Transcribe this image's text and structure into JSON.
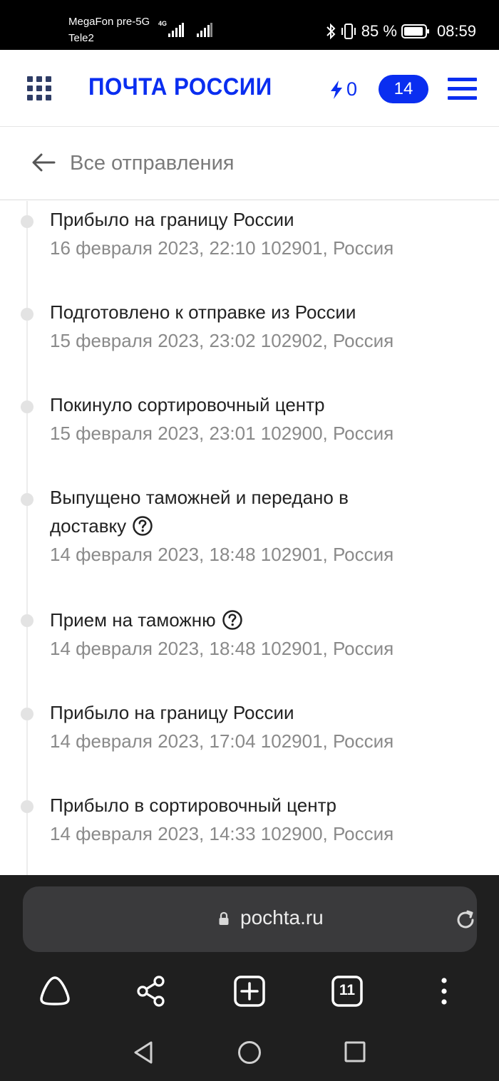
{
  "status_bar": {
    "carrier_primary": "MegaFon pre-5G",
    "carrier_secondary": "Tele2",
    "network_type": "4G",
    "battery_percent": "85 %",
    "time": "08:59",
    "icons": [
      "signal-icon",
      "bluetooth-icon",
      "vibrate-icon",
      "battery-icon"
    ]
  },
  "header": {
    "logo_text": "ПОЧТА РОССИИ",
    "bolt_count": "0",
    "badge_count": "14",
    "accent_color": "#0a2ef0"
  },
  "subheader": {
    "back_label": "Все отправления"
  },
  "events": [
    {
      "title": "Прибыло на границу России",
      "datetime": "16 февраля 2023, 22:10",
      "location": "102901, Россия",
      "meta": "16 февраля 2023, 22:10 102901, Россия",
      "help": false
    },
    {
      "title": "Подготовлено к отправке из России",
      "datetime": "15 февраля 2023, 23:02",
      "location": "102902, Россия",
      "meta": "15 февраля 2023, 23:02 102902, Россия",
      "help": false
    },
    {
      "title": "Покинуло сортировочный центр",
      "datetime": "15 февраля 2023, 23:01",
      "location": "102900, Россия",
      "meta": "15 февраля 2023, 23:01 102900, Россия",
      "help": false
    },
    {
      "title_line1": "Выпущено таможней и передано в",
      "title_line2": "доставку",
      "datetime": "14 февраля 2023, 18:48",
      "location": "102901, Россия",
      "meta": "14 февраля 2023, 18:48 102901, Россия",
      "help": true
    },
    {
      "title": "Прием на таможню",
      "datetime": "14 февраля 2023, 18:48",
      "location": "102901, Россия",
      "meta": "14 февраля 2023, 18:48 102901, Россия",
      "help": true
    },
    {
      "title": "Прибыло на границу России",
      "datetime": "14 февраля 2023, 17:04",
      "location": "102901, Россия",
      "meta": "14 февраля 2023, 17:04 102901, Россия",
      "help": false
    },
    {
      "title": "Прибыло в сортировочный центр",
      "datetime": "14 февраля 2023, 14:33",
      "location": "102900, Россия",
      "meta": "14 февраля 2023, 14:33 102900, Россия",
      "help": false
    }
  ],
  "browser": {
    "url": "pochta.ru",
    "tab_count": "11",
    "toolbar_icons": [
      "home-icon",
      "share-icon",
      "new-tab-icon",
      "tabs-icon",
      "more-icon"
    ]
  }
}
